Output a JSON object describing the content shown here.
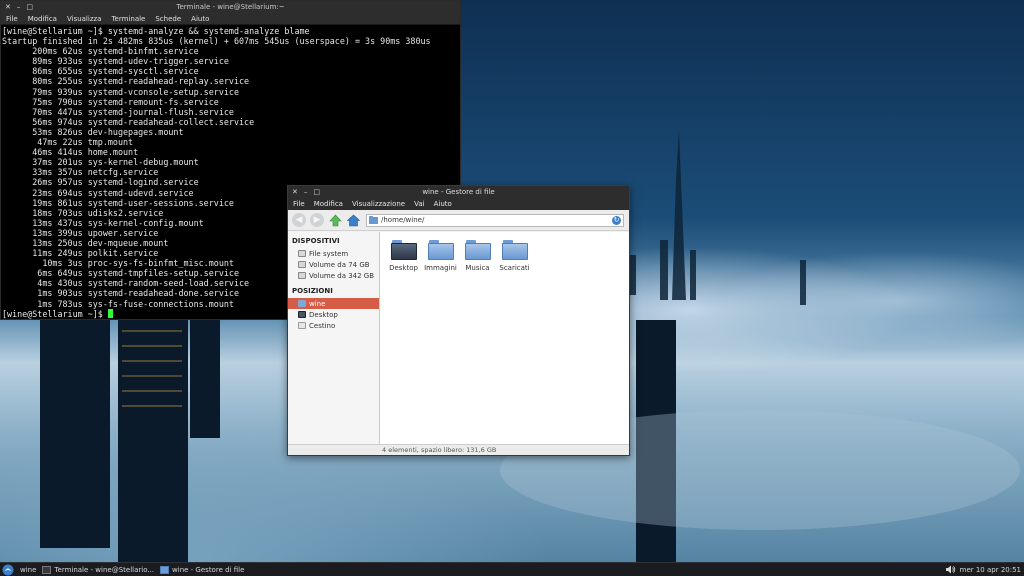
{
  "terminal": {
    "title": "Terminale - wine@Stellarium:~",
    "menu": [
      "File",
      "Modifica",
      "Visualizza",
      "Terminale",
      "Schede",
      "Aiuto"
    ],
    "lines": [
      "[wine@Stellarium ~]$ systemd-analyze && systemd-analyze blame",
      "Startup finished in 2s 482ms 835us (kernel) + 607ms 545us (userspace) = 3s 90ms 380us",
      "      200ms 62us systemd-binfmt.service",
      "      89ms 933us systemd-udev-trigger.service",
      "      86ms 655us systemd-sysctl.service",
      "      80ms 255us systemd-readahead-replay.service",
      "      79ms 939us systemd-vconsole-setup.service",
      "      75ms 790us systemd-remount-fs.service",
      "      70ms 447us systemd-journal-flush.service",
      "      56ms 974us systemd-readahead-collect.service",
      "      53ms 826us dev-hugepages.mount",
      "       47ms 22us tmp.mount",
      "      46ms 414us home.mount",
      "      37ms 201us sys-kernel-debug.mount",
      "      33ms 357us netcfg.service",
      "      26ms 957us systemd-logind.service",
      "      23ms 694us systemd-udevd.service",
      "      19ms 861us systemd-user-sessions.service",
      "      18ms 703us udisks2.service",
      "      13ms 437us sys-kernel-config.mount",
      "      13ms 399us upower.service",
      "      13ms 250us dev-mqueue.mount",
      "      11ms 249us polkit.service",
      "        10ms 3us proc-sys-fs-binfmt_misc.mount",
      "       6ms 649us systemd-tmpfiles-setup.service",
      "       4ms 430us systemd-random-seed-load.service",
      "       1ms 903us systemd-readahead-done.service",
      "       1ms 783us sys-fs-fuse-connections.mount"
    ],
    "prompt": "[wine@Stellarium ~]$ "
  },
  "file_manager": {
    "title": "wine - Gestore di file",
    "menu": [
      "File",
      "Modifica",
      "Visualizzazione",
      "Vai",
      "Aiuto"
    ],
    "path": "/home/wine/",
    "sidebar": {
      "devices_header": "DISPOSITIVI",
      "devices": [
        "File system",
        "Volume da 74 GB",
        "Volume da 342 GB"
      ],
      "places_header": "POSIZIONI",
      "places": [
        "wine",
        "Desktop",
        "Cestino"
      ]
    },
    "items": [
      "Desktop",
      "Immagini",
      "Musica",
      "Scaricati"
    ],
    "status": "4 elementi, spazio libero: 131,6 GB"
  },
  "taskbar": {
    "tasks": [
      "wine",
      "Terminale - wine@Stellario...",
      "wine - Gestore di file"
    ],
    "clock": "mer 10 apr 20:51"
  },
  "colors": {
    "selection": "#d55c45",
    "folder": "#6a98d2"
  }
}
